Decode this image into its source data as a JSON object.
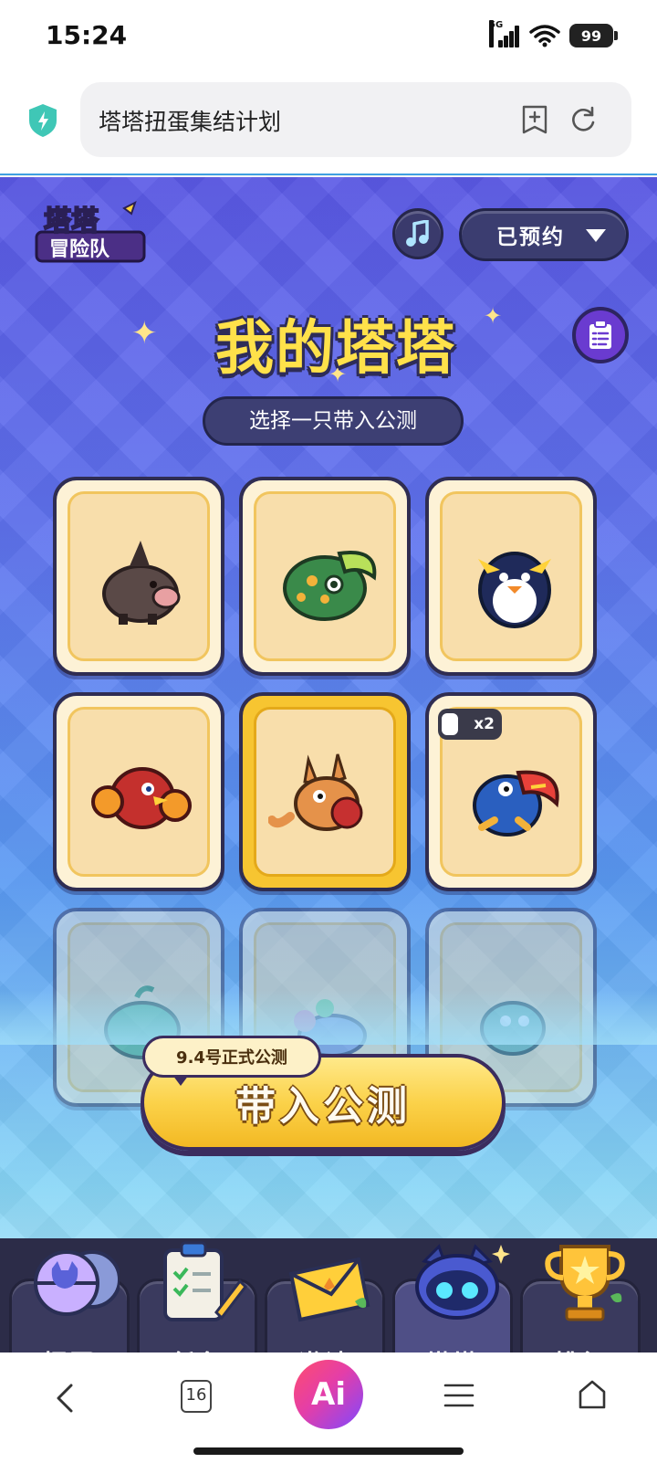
{
  "status_bar": {
    "time": "15:24",
    "network": "5G",
    "battery": "99"
  },
  "browser": {
    "url_title": "塔塔扭蛋集结计划",
    "tab_count": "16",
    "ai_label": "Ai"
  },
  "game": {
    "logo_line1": "塔塔",
    "logo_line2": "冒险队",
    "reserve_label": "已预约",
    "title": "我的塔塔",
    "subtitle": "选择一只带入公测",
    "cards": [
      {
        "creature": "boar-icon",
        "selected": false
      },
      {
        "creature": "frog-icon",
        "selected": false
      },
      {
        "creature": "penguin-icon",
        "selected": false
      },
      {
        "creature": "red-bird-icon",
        "selected": false
      },
      {
        "creature": "kangaroo-icon",
        "selected": true
      },
      {
        "creature": "toucan-icon",
        "selected": false,
        "badge": "x2"
      },
      {
        "creature": "green-blob-icon",
        "selected": false
      },
      {
        "creature": "flower-creature-icon",
        "selected": false
      },
      {
        "creature": "turtle-icon",
        "selected": false
      }
    ],
    "cta_tag": "9.4号正式公测",
    "cta_label": "带入公测",
    "nav": [
      {
        "label": "扭蛋",
        "icon": "capsule-icon"
      },
      {
        "label": "任务",
        "icon": "clipboard-icon"
      },
      {
        "label": "邀请",
        "icon": "envelope-icon"
      },
      {
        "label": "塔塔",
        "icon": "cat-robot-icon",
        "active": true
      },
      {
        "label": "排行",
        "icon": "trophy-icon"
      }
    ]
  }
}
